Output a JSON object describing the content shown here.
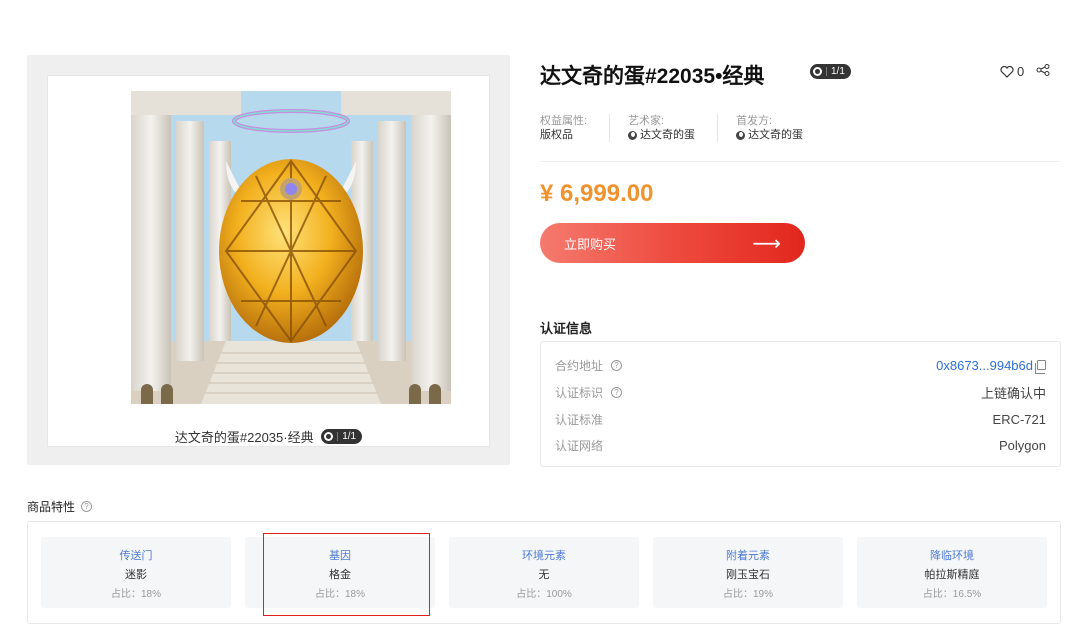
{
  "product": {
    "title": "达文奇的蛋#22035•经典",
    "caption": "达文奇的蛋#22035·经典",
    "edition": "1/1",
    "likes": "0",
    "price": "¥ 6,999.00",
    "buy_label": "立即购买"
  },
  "attributes": [
    {
      "key": "权益属性:",
      "value": "版权品"
    },
    {
      "key": "艺术家:",
      "value": "达文奇的蛋"
    },
    {
      "key": "首发方:",
      "value": "达文奇的蛋"
    }
  ],
  "certification": {
    "title": "认证信息",
    "rows": [
      {
        "label": "合约地址",
        "value": "0x8673...994b6d"
      },
      {
        "label": "认证标识",
        "value": "上链确认中"
      },
      {
        "label": "认证标准",
        "value": "ERC-721"
      },
      {
        "label": "认证网络",
        "value": "Polygon"
      }
    ]
  },
  "traits": {
    "title": "商品特性",
    "items": [
      {
        "name": "传送门",
        "value": "迷影",
        "ratio": "占比：18%"
      },
      {
        "name": "基因",
        "value": "格金",
        "ratio": "占比：18%"
      },
      {
        "name": "环境元素",
        "value": "无",
        "ratio": "占比：100%"
      },
      {
        "name": "附着元素",
        "value": "刚玉宝石",
        "ratio": "占比：19%"
      },
      {
        "name": "降临环境",
        "value": "帕拉斯精庭",
        "ratio": "占比：16.5%"
      }
    ]
  },
  "colors": {
    "price": "#f0932e",
    "buy_start": "#f57a6e",
    "buy_end": "#e2271d",
    "link": "#2e6fd8",
    "highlight": "#e0201c"
  }
}
